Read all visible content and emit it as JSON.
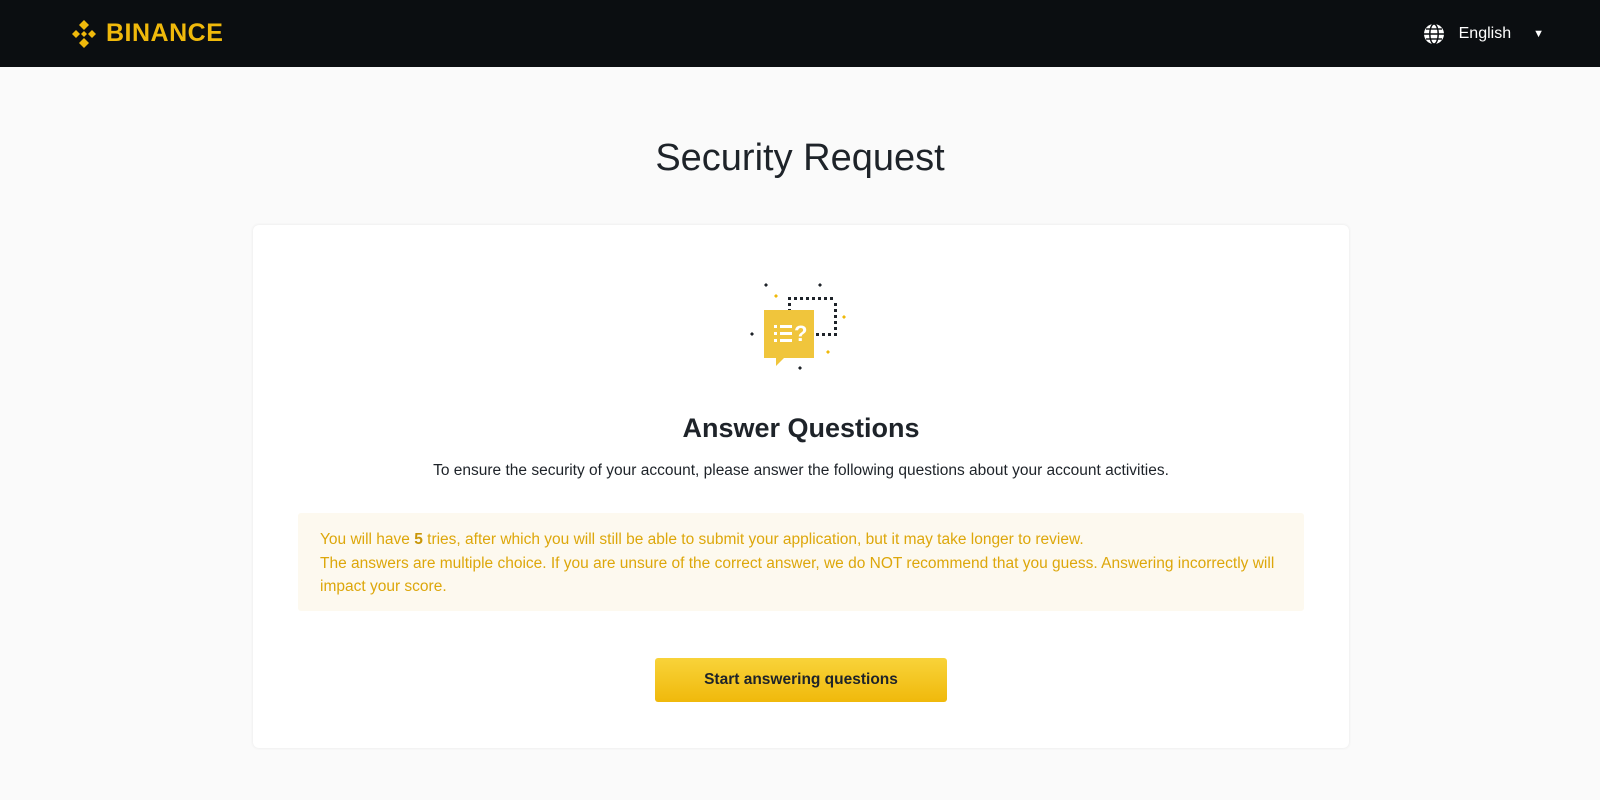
{
  "header": {
    "logo_text": "BINANCE",
    "language": "English",
    "brand_color": "#f0b90b",
    "icons": {
      "logo": "binance-diamond-logo",
      "language": "globe-icon",
      "caret": "caret-down-icon"
    }
  },
  "page": {
    "title": "Security Request"
  },
  "card": {
    "illustration": "question-chat-illustration",
    "title": "Answer Questions",
    "description": "To ensure the security of your account, please answer the following questions about your account activities.",
    "notice": {
      "line1_prefix": "You will have ",
      "line1_count": "5",
      "line1_suffix": " tries, after which you will still be able to submit your application, but it may take longer to review.",
      "line2": "The answers are multiple choice. If you are unsure of the correct answer, we do NOT recommend that you guess. Answering incorrectly will impact your score."
    },
    "cta_label": "Start answering questions"
  }
}
